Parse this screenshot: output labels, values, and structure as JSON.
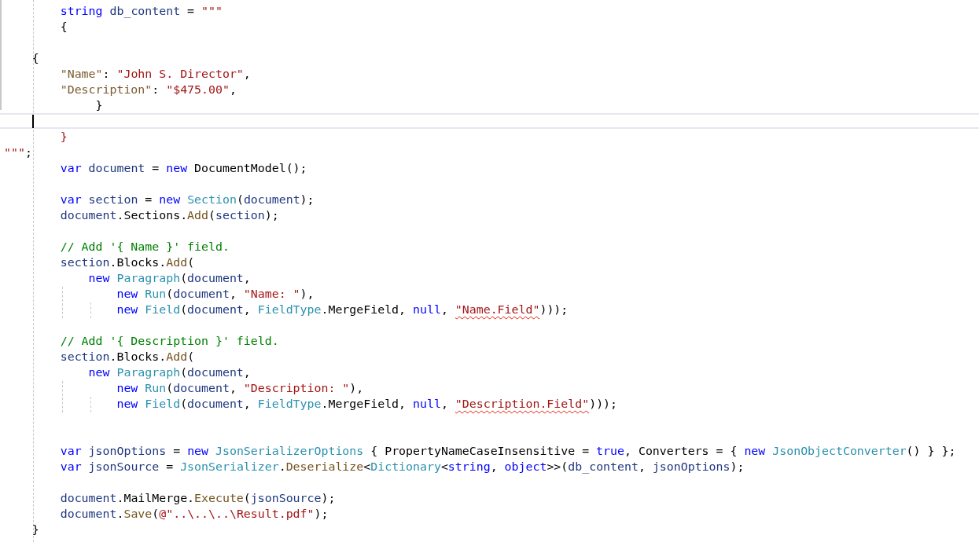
{
  "editor": {
    "lines": [
      {
        "kind": "code",
        "tokens": [
          {
            "kind": "kw",
            "text": "string "
          },
          {
            "kind": "local",
            "text": "db_content"
          },
          {
            "kind": "plain",
            "text": " = "
          },
          {
            "kind": "str",
            "text": "\"\"\""
          }
        ]
      },
      {
        "kind": "code",
        "tokens": [
          {
            "kind": "plain",
            "text": "{"
          }
        ]
      },
      {
        "kind": "blank"
      },
      {
        "kind": "code",
        "tokens": [
          {
            "kind": "plain",
            "text": "{"
          }
        ]
      },
      {
        "kind": "code",
        "tokens": [
          {
            "kind": "jkey",
            "text": "\"Name\""
          },
          {
            "kind": "plain",
            "text": ": "
          },
          {
            "kind": "str",
            "text": "\"John S. Director\""
          },
          {
            "kind": "plain",
            "text": ","
          }
        ]
      },
      {
        "kind": "code",
        "tokens": [
          {
            "kind": "jkey",
            "text": "\"Description\""
          },
          {
            "kind": "plain",
            "text": ": "
          },
          {
            "kind": "str",
            "text": "\"$475.00\""
          },
          {
            "kind": "plain",
            "text": ","
          }
        ]
      },
      {
        "kind": "code",
        "tokens": [
          {
            "kind": "plain",
            "text": "}"
          }
        ]
      },
      {
        "kind": "caret"
      },
      {
        "kind": "code",
        "tokens": [
          {
            "kind": "str",
            "text": "}"
          }
        ]
      },
      {
        "kind": "code",
        "tokens": [
          {
            "kind": "str",
            "text": "\"\"\""
          },
          {
            "kind": "plain",
            "text": ";"
          }
        ]
      },
      {
        "kind": "code",
        "tokens": [
          {
            "kind": "kw",
            "text": "var "
          },
          {
            "kind": "local",
            "text": "document"
          },
          {
            "kind": "plain",
            "text": " = "
          },
          {
            "kind": "kw",
            "text": "new"
          },
          {
            "kind": "plain",
            "text": " DocumentModel();"
          }
        ]
      },
      {
        "kind": "blank"
      },
      {
        "kind": "code",
        "tokens": [
          {
            "kind": "kw",
            "text": "var "
          },
          {
            "kind": "local",
            "text": "section"
          },
          {
            "kind": "plain",
            "text": " = "
          },
          {
            "kind": "kw",
            "text": "new "
          },
          {
            "kind": "type",
            "text": "Section"
          },
          {
            "kind": "plain",
            "text": "("
          },
          {
            "kind": "local",
            "text": "document"
          },
          {
            "kind": "plain",
            "text": ");"
          }
        ]
      },
      {
        "kind": "code",
        "tokens": [
          {
            "kind": "local",
            "text": "document"
          },
          {
            "kind": "plain",
            "text": ".Sections."
          },
          {
            "kind": "method",
            "text": "Add"
          },
          {
            "kind": "plain",
            "text": "("
          },
          {
            "kind": "local",
            "text": "section"
          },
          {
            "kind": "plain",
            "text": ");"
          }
        ]
      },
      {
        "kind": "blank"
      },
      {
        "kind": "code",
        "tokens": [
          {
            "kind": "comment",
            "text": "// Add '{ Name }' field."
          }
        ]
      },
      {
        "kind": "code",
        "tokens": [
          {
            "kind": "local",
            "text": "section"
          },
          {
            "kind": "plain",
            "text": ".Blocks."
          },
          {
            "kind": "method",
            "text": "Add"
          },
          {
            "kind": "plain",
            "text": "("
          }
        ]
      },
      {
        "kind": "code",
        "tokens": [
          {
            "kind": "kw",
            "text": "new "
          },
          {
            "kind": "type",
            "text": "Paragraph"
          },
          {
            "kind": "plain",
            "text": "("
          },
          {
            "kind": "local",
            "text": "document"
          },
          {
            "kind": "plain",
            "text": ","
          }
        ]
      },
      {
        "kind": "code",
        "tokens": [
          {
            "kind": "kw",
            "text": "new "
          },
          {
            "kind": "type",
            "text": "Run"
          },
          {
            "kind": "plain",
            "text": "("
          },
          {
            "kind": "local",
            "text": "document"
          },
          {
            "kind": "plain",
            "text": ", "
          },
          {
            "kind": "str",
            "text": "\"Name: \""
          },
          {
            "kind": "plain",
            "text": "),"
          }
        ]
      },
      {
        "kind": "code",
        "tokens": [
          {
            "kind": "kw",
            "text": "new "
          },
          {
            "kind": "type",
            "text": "Field"
          },
          {
            "kind": "plain",
            "text": "("
          },
          {
            "kind": "local",
            "text": "document"
          },
          {
            "kind": "plain",
            "text": ", "
          },
          {
            "kind": "type",
            "text": "FieldType"
          },
          {
            "kind": "plain",
            "text": ".MergeField, "
          },
          {
            "kind": "kw",
            "text": "null"
          },
          {
            "kind": "plain",
            "text": ", "
          },
          {
            "kind": "str",
            "text": "\"Name.Field\"",
            "squiggle": true
          },
          {
            "kind": "plain",
            "text": ")));"
          }
        ]
      },
      {
        "kind": "blank"
      },
      {
        "kind": "code",
        "tokens": [
          {
            "kind": "comment",
            "text": "// Add '{ Description }' field."
          }
        ]
      },
      {
        "kind": "code",
        "tokens": [
          {
            "kind": "local",
            "text": "section"
          },
          {
            "kind": "plain",
            "text": ".Blocks."
          },
          {
            "kind": "method",
            "text": "Add"
          },
          {
            "kind": "plain",
            "text": "("
          }
        ]
      },
      {
        "kind": "code",
        "tokens": [
          {
            "kind": "kw",
            "text": "new "
          },
          {
            "kind": "type",
            "text": "Paragraph"
          },
          {
            "kind": "plain",
            "text": "("
          },
          {
            "kind": "local",
            "text": "document"
          },
          {
            "kind": "plain",
            "text": ","
          }
        ]
      },
      {
        "kind": "code",
        "tokens": [
          {
            "kind": "kw",
            "text": "new "
          },
          {
            "kind": "type",
            "text": "Run"
          },
          {
            "kind": "plain",
            "text": "("
          },
          {
            "kind": "local",
            "text": "document"
          },
          {
            "kind": "plain",
            "text": ", "
          },
          {
            "kind": "str",
            "text": "\"Description: \""
          },
          {
            "kind": "plain",
            "text": "),"
          }
        ]
      },
      {
        "kind": "code",
        "tokens": [
          {
            "kind": "kw",
            "text": "new "
          },
          {
            "kind": "type",
            "text": "Field"
          },
          {
            "kind": "plain",
            "text": "("
          },
          {
            "kind": "local",
            "text": "document"
          },
          {
            "kind": "plain",
            "text": ", "
          },
          {
            "kind": "type",
            "text": "FieldType"
          },
          {
            "kind": "plain",
            "text": ".MergeField, "
          },
          {
            "kind": "kw",
            "text": "null"
          },
          {
            "kind": "plain",
            "text": ", "
          },
          {
            "kind": "str",
            "text": "\"Description.Field\"",
            "squiggle": true
          },
          {
            "kind": "plain",
            "text": ")));"
          }
        ]
      },
      {
        "kind": "blank"
      },
      {
        "kind": "blank"
      },
      {
        "kind": "code",
        "tokens": [
          {
            "kind": "kw",
            "text": "var "
          },
          {
            "kind": "local",
            "text": "jsonOptions"
          },
          {
            "kind": "plain",
            "text": " = "
          },
          {
            "kind": "kw",
            "text": "new "
          },
          {
            "kind": "type",
            "text": "JsonSerializerOptions"
          },
          {
            "kind": "plain",
            "text": " { PropertyNameCaseInsensitive = "
          },
          {
            "kind": "kw",
            "text": "true"
          },
          {
            "kind": "plain",
            "text": ", Converters = { "
          },
          {
            "kind": "kw",
            "text": "new "
          },
          {
            "kind": "type",
            "text": "JsonObjectConverter"
          },
          {
            "kind": "plain",
            "text": "() } };"
          }
        ]
      },
      {
        "kind": "code",
        "tokens": [
          {
            "kind": "kw",
            "text": "var "
          },
          {
            "kind": "local",
            "text": "jsonSource"
          },
          {
            "kind": "plain",
            "text": " = "
          },
          {
            "kind": "type",
            "text": "JsonSerializer"
          },
          {
            "kind": "plain",
            "text": "."
          },
          {
            "kind": "method",
            "text": "Deserialize"
          },
          {
            "kind": "plain",
            "text": "<"
          },
          {
            "kind": "type",
            "text": "Dictionary"
          },
          {
            "kind": "plain",
            "text": "<"
          },
          {
            "kind": "kw",
            "text": "string"
          },
          {
            "kind": "plain",
            "text": ", "
          },
          {
            "kind": "kw",
            "text": "object"
          },
          {
            "kind": "plain",
            "text": ">>("
          },
          {
            "kind": "local",
            "text": "db_content"
          },
          {
            "kind": "plain",
            "text": ", "
          },
          {
            "kind": "local",
            "text": "jsonOptions"
          },
          {
            "kind": "plain",
            "text": ");"
          }
        ]
      },
      {
        "kind": "blank"
      },
      {
        "kind": "code",
        "tokens": [
          {
            "kind": "local",
            "text": "document"
          },
          {
            "kind": "plain",
            "text": ".MailMerge."
          },
          {
            "kind": "method",
            "text": "Execute"
          },
          {
            "kind": "plain",
            "text": "("
          },
          {
            "kind": "local",
            "text": "jsonSource"
          },
          {
            "kind": "plain",
            "text": ");"
          }
        ]
      },
      {
        "kind": "code",
        "tokens": [
          {
            "kind": "local",
            "text": "document"
          },
          {
            "kind": "plain",
            "text": "."
          },
          {
            "kind": "method",
            "text": "Save"
          },
          {
            "kind": "plain",
            "text": "("
          },
          {
            "kind": "str",
            "text": "@\"..\\..\\..\\Result.pdf\""
          },
          {
            "kind": "plain",
            "text": ");"
          }
        ]
      },
      {
        "kind": "code",
        "tokens": [
          {
            "kind": "plain",
            "text": "}"
          }
        ]
      }
    ]
  }
}
